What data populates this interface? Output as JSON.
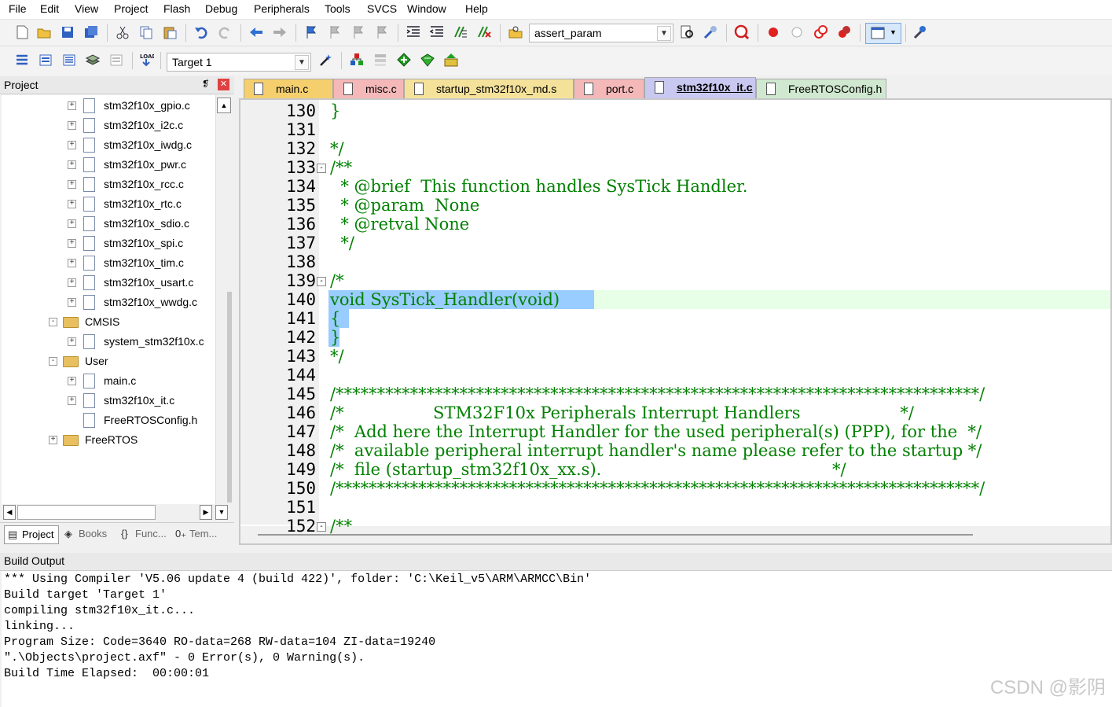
{
  "menu": [
    "File",
    "Edit",
    "View",
    "Project",
    "Flash",
    "Debug",
    "Peripherals",
    "Tools",
    "SVCS",
    "Window",
    "Help"
  ],
  "toolbar": {
    "find_combo": "assert_param",
    "target_combo": "Target 1"
  },
  "project_pane": {
    "title": "Project",
    "pin": "❡",
    "close": "✕",
    "tree": [
      {
        "label": "stm32f10x_gpio.c",
        "indent": 2,
        "kind": "file",
        "exp": "+"
      },
      {
        "label": "stm32f10x_i2c.c",
        "indent": 2,
        "kind": "file",
        "exp": "+"
      },
      {
        "label": "stm32f10x_iwdg.c",
        "indent": 2,
        "kind": "file",
        "exp": "+"
      },
      {
        "label": "stm32f10x_pwr.c",
        "indent": 2,
        "kind": "file",
        "exp": "+"
      },
      {
        "label": "stm32f10x_rcc.c",
        "indent": 2,
        "kind": "file",
        "exp": "+"
      },
      {
        "label": "stm32f10x_rtc.c",
        "indent": 2,
        "kind": "file",
        "exp": "+"
      },
      {
        "label": "stm32f10x_sdio.c",
        "indent": 2,
        "kind": "file",
        "exp": "+"
      },
      {
        "label": "stm32f10x_spi.c",
        "indent": 2,
        "kind": "file",
        "exp": "+"
      },
      {
        "label": "stm32f10x_tim.c",
        "indent": 2,
        "kind": "file",
        "exp": "+"
      },
      {
        "label": "stm32f10x_usart.c",
        "indent": 2,
        "kind": "file",
        "exp": "+"
      },
      {
        "label": "stm32f10x_wwdg.c",
        "indent": 2,
        "kind": "file",
        "exp": "+"
      },
      {
        "label": "CMSIS",
        "indent": 1,
        "kind": "folder",
        "exp": "-"
      },
      {
        "label": "system_stm32f10x.c",
        "indent": 2,
        "kind": "file",
        "exp": "+"
      },
      {
        "label": "User",
        "indent": 1,
        "kind": "folder",
        "exp": "-"
      },
      {
        "label": "main.c",
        "indent": 2,
        "kind": "file",
        "exp": "+"
      },
      {
        "label": "stm32f10x_it.c",
        "indent": 2,
        "kind": "file",
        "exp": "+"
      },
      {
        "label": "FreeRTOSConfig.h",
        "indent": 2,
        "kind": "file",
        "exp": ""
      },
      {
        "label": "FreeRTOS",
        "indent": 1,
        "kind": "folder",
        "exp": "+"
      }
    ],
    "tabs": [
      {
        "label": "Project",
        "active": true,
        "icon": "▤"
      },
      {
        "label": "Books",
        "active": false,
        "icon": "◈"
      },
      {
        "label": "Func...",
        "active": false,
        "icon": "{}"
      },
      {
        "label": "Tem...",
        "active": false,
        "icon": "0₊"
      }
    ]
  },
  "editor_tabs": [
    {
      "label": "main.c",
      "color": "#f5cf6e",
      "active": false
    },
    {
      "label": "misc.c",
      "color": "#f4b8b8",
      "active": false
    },
    {
      "label": "startup_stm32f10x_md.s",
      "color": "#f5e29a",
      "active": false
    },
    {
      "label": "port.c",
      "color": "#f4b8b8",
      "active": false
    },
    {
      "label": "stm32f10x_it.c",
      "color": "#c8c8f0",
      "active": true
    },
    {
      "label": "FreeRTOSConfig.h",
      "color": "#cfe8cf",
      "active": false
    }
  ],
  "code": [
    {
      "n": "130",
      "t": "}",
      "c": "g",
      "fold": ""
    },
    {
      "n": "131",
      "t": "",
      "c": "g",
      "fold": ""
    },
    {
      "n": "132",
      "t": "*/",
      "c": "g",
      "fold": ""
    },
    {
      "n": "133",
      "t": "/**",
      "c": "g",
      "fold": "-"
    },
    {
      "n": "134",
      "t": "  * @brief  This function handles SysTick Handler.",
      "c": "g",
      "fold": ""
    },
    {
      "n": "135",
      "t": "  * @param  None",
      "c": "g",
      "fold": ""
    },
    {
      "n": "136",
      "t": "  * @retval None",
      "c": "g",
      "fold": ""
    },
    {
      "n": "137",
      "t": "  */",
      "c": "g",
      "fold": ""
    },
    {
      "n": "138",
      "t": "",
      "c": "g",
      "fold": ""
    },
    {
      "n": "139",
      "t": "/*",
      "c": "g",
      "fold": "-"
    },
    {
      "n": "140",
      "t": "void SysTick_Handler(void)",
      "c": "g",
      "fold": ""
    },
    {
      "n": "141",
      "t": "{",
      "c": "g",
      "fold": ""
    },
    {
      "n": "142",
      "t": "}",
      "c": "g",
      "fold": ""
    },
    {
      "n": "143",
      "t": "*/",
      "c": "g",
      "fold": ""
    },
    {
      "n": "144",
      "t": "",
      "c": "g",
      "fold": ""
    },
    {
      "n": "145",
      "t": "/******************************************************************************/",
      "c": "g",
      "fold": ""
    },
    {
      "n": "146",
      "t": "/*                 STM32F10x Peripherals Interrupt Handlers                   */",
      "c": "g",
      "fold": ""
    },
    {
      "n": "147",
      "t": "/*  Add here the Interrupt Handler for the used peripheral(s) (PPP), for the  */",
      "c": "g",
      "fold": ""
    },
    {
      "n": "148",
      "t": "/*  available peripheral interrupt handler's name please refer to the startup */",
      "c": "g",
      "fold": ""
    },
    {
      "n": "149",
      "t": "/*  file (startup_stm32f10x_xx.s).                                            */",
      "c": "g",
      "fold": ""
    },
    {
      "n": "150",
      "t": "/******************************************************************************/",
      "c": "g",
      "fold": ""
    },
    {
      "n": "151",
      "t": "",
      "c": "g",
      "fold": ""
    },
    {
      "n": "152",
      "t": "/**",
      "c": "g",
      "fold": "-"
    }
  ],
  "build_output": {
    "title": "Build Output",
    "lines": [
      "*** Using Compiler 'V5.06 update 4 (build 422)', folder: 'C:\\Keil_v5\\ARM\\ARMCC\\Bin'",
      "Build target 'Target 1'",
      "compiling stm32f10x_it.c...",
      "linking...",
      "Program Size: Code=3640 RO-data=268 RW-data=104 ZI-data=19240",
      "\".\\Objects\\project.axf\" - 0 Error(s), 0 Warning(s).",
      "Build Time Elapsed:  00:00:01"
    ]
  },
  "watermark": "CSDN @影阴",
  "colors": {
    "accent": "#99ccff",
    "current_line": "#e6ffe6",
    "comment": "#008000"
  }
}
